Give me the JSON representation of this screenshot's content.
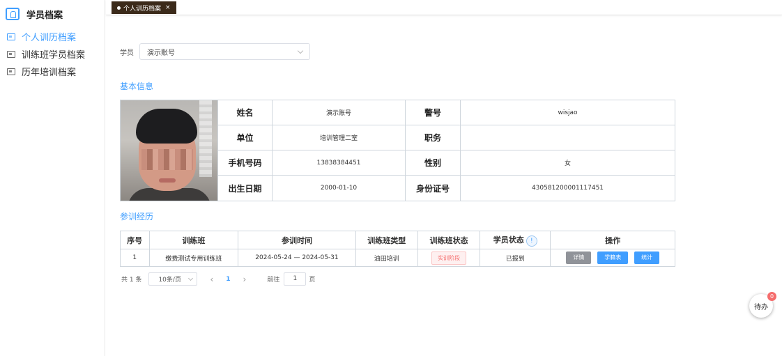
{
  "sidebar": {
    "title": "学员档案",
    "items": [
      {
        "label": "个人训历档案",
        "active": true
      },
      {
        "label": "训练班学员档案",
        "active": false
      },
      {
        "label": "历年培训档案",
        "active": false
      }
    ]
  },
  "tabs": [
    {
      "label": "个人训历档案",
      "close": "×"
    }
  ],
  "filter": {
    "label": "学员",
    "value": "演示账号"
  },
  "basic": {
    "title": "基本信息",
    "rows": [
      {
        "k1": "姓名",
        "v1": "演示账号",
        "k2": "警号",
        "v2": "wisjao"
      },
      {
        "k1": "单位",
        "v1": "培训管理二室",
        "k2": "职务",
        "v2": ""
      },
      {
        "k1": "手机号码",
        "v1": "13838384451",
        "k2": "性别",
        "v2": "女"
      },
      {
        "k1": "出生日期",
        "v1": "2000-01-10",
        "k2": "身份证号",
        "v2": "430581200001117451"
      }
    ]
  },
  "experience": {
    "title": "参训经历",
    "headers": [
      "序号",
      "训练班",
      "参训时间",
      "训练班类型",
      "训练班状态",
      "学员状态",
      "操作"
    ],
    "info_icon": "!",
    "rows": [
      {
        "no": "1",
        "class": "缴费测试专用训练班",
        "time": "2024-05-24 — 2024-05-31",
        "type": "油田培训",
        "status": "实训阶段",
        "student_status": "已报到"
      }
    ],
    "actions": {
      "detail": "详情",
      "archive": "学籍表",
      "stats": "统计"
    }
  },
  "pagination": {
    "total": "共 1 条",
    "page_size": "10条/页",
    "prev": "‹",
    "current": "1",
    "next": "›",
    "goto_label": "前往",
    "goto_value": "1",
    "page_suffix": "页"
  },
  "todo": {
    "label": "待办",
    "badge": "0"
  },
  "colors": {
    "accent": "#409eff",
    "tab_bg": "#3b2a1a",
    "danger": "#f56c6c"
  }
}
